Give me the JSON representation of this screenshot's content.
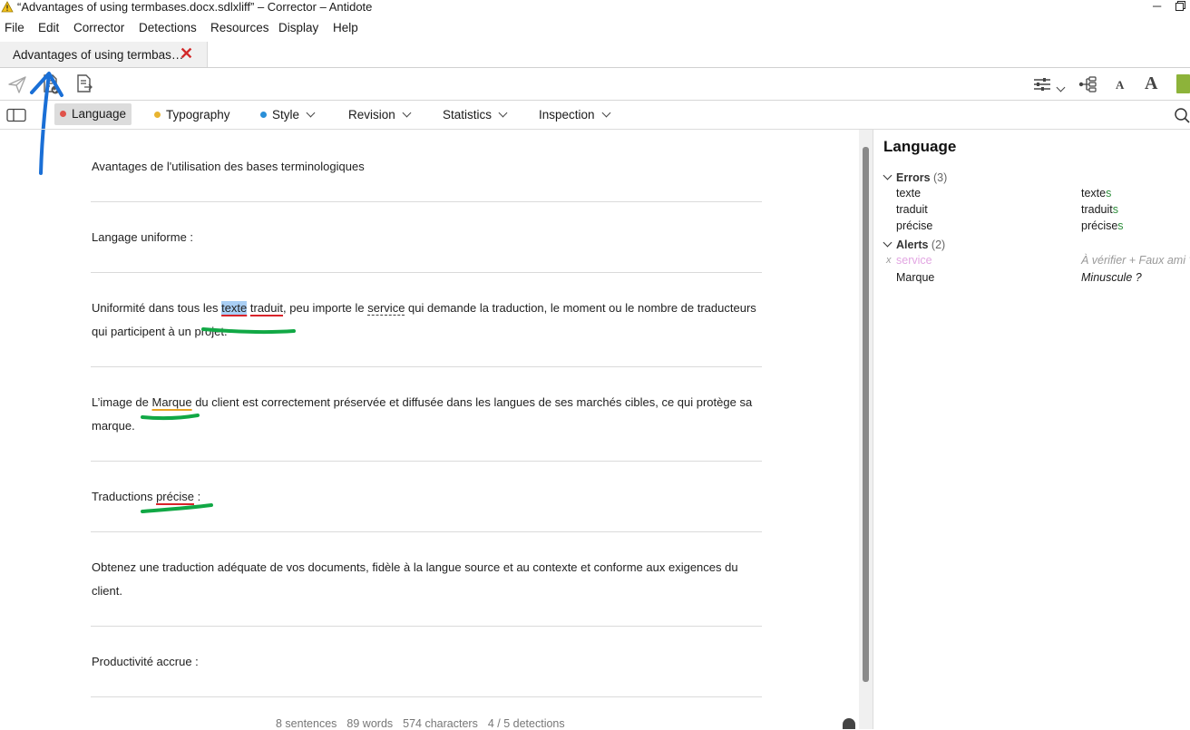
{
  "window": {
    "title": "“Advantages of using termbases.docx.sdlxliff” – Corrector – Antidote"
  },
  "menu": [
    "File",
    "Edit",
    "Corrector",
    "Detections",
    "Resources",
    "Display",
    "Help"
  ],
  "tab": {
    "label": "Advantages of using termbas…",
    "close": "✕"
  },
  "toolbar": {
    "icons": [
      "send-icon",
      "document-check-icon",
      "document-list-icon",
      "settings-sliders-icon",
      "tree-view-icon",
      "font-decrease-icon",
      "font-increase-icon",
      "bookmark-icon"
    ],
    "font_small": "A",
    "font_large": "A"
  },
  "filters": {
    "language": "Language",
    "typography": "Typography",
    "style": "Style",
    "revision": "Revision",
    "statistics": "Statistics",
    "inspection": "Inspection",
    "colors": {
      "language": "#e0524a",
      "typography": "#e8b431",
      "style": "#2a8fd8"
    }
  },
  "document": {
    "p1": "Avantages de l'utilisation des bases terminologiques",
    "p2": "Langage uniforme :",
    "p3": {
      "a": "Uniformité dans tous les ",
      "texte": "texte",
      "sp1": " ",
      "traduit": "traduit",
      "b": ", peu importe le ",
      "service": "service",
      "c": " qui demande la traduction, le moment ou le nombre de traducteurs qui participent à un projet."
    },
    "p4": {
      "a": "L’image de ",
      "marque": "Marque",
      "b": " du client est correctement préservée et diffusée dans les langues de ses marchés cibles, ce qui protège sa marque."
    },
    "p5": {
      "a": "Traductions ",
      "precise": "précise",
      "b": " :"
    },
    "p6": "Obtenez une traduction adéquate de vos documents, fidèle à la langue source et au contexte et conforme aux exigences du client.",
    "p7": "Productivité accrue :"
  },
  "status": {
    "sentences": "8 sentences",
    "words": "89 words",
    "characters": "574 characters",
    "detections": "4 / 5 detections"
  },
  "panel": {
    "title": "Language",
    "errors": {
      "label": "Errors",
      "count": "(3)",
      "items": [
        {
          "word": "texte",
          "base": "texte",
          "add": "s"
        },
        {
          "word": "traduit",
          "base": "traduit",
          "add": "s"
        },
        {
          "word": "précise",
          "base": "précise",
          "add": "s"
        }
      ]
    },
    "alerts": {
      "label": "Alerts",
      "count": "(2)",
      "items": [
        {
          "mark": "x",
          "word": "service",
          "note": "À vérifier + Faux ami ?"
        },
        {
          "word": "Marque",
          "note": "Minuscule ?"
        }
      ]
    }
  }
}
